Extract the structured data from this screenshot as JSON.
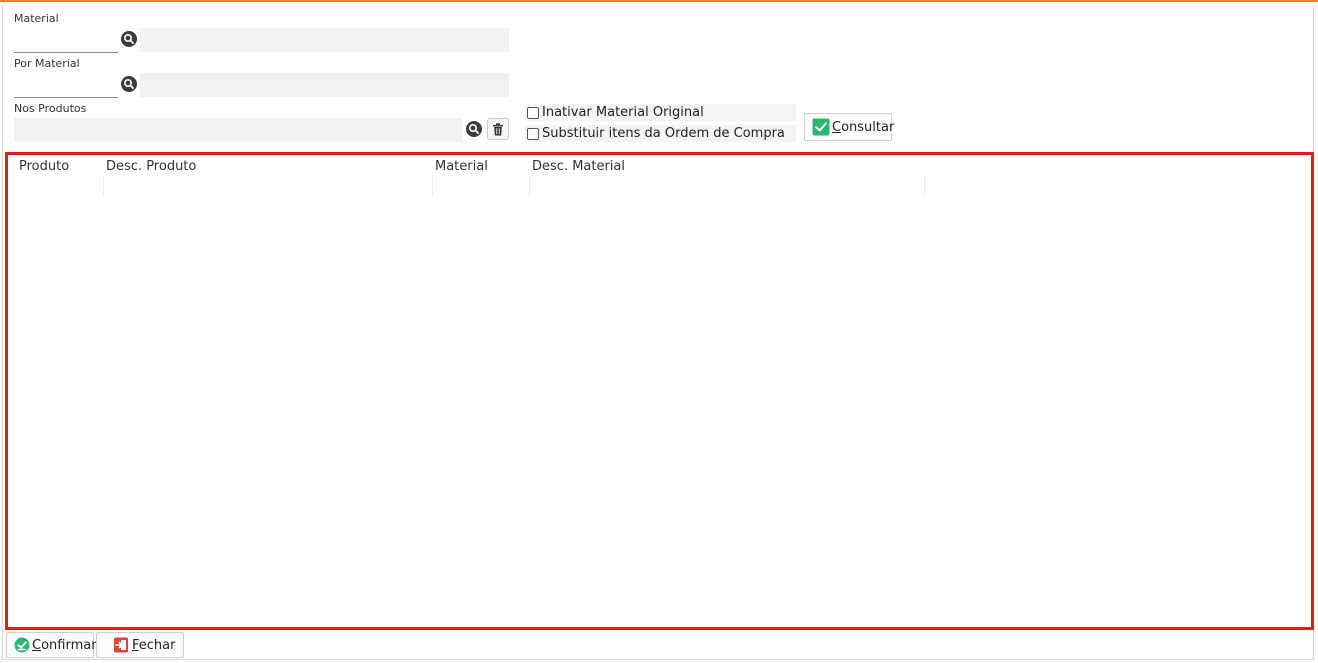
{
  "form": {
    "material_label": "Material",
    "material_value": "",
    "material_desc": "",
    "por_material_label": "Por Material",
    "por_material_value": "",
    "por_material_desc": "",
    "nos_produtos_label": "Nos Produtos",
    "nos_produtos_value": ""
  },
  "options": {
    "inativar_label": "Inativar Material Original",
    "inativar_checked": false,
    "substituir_label": "Substituir itens da Ordem de Compra",
    "substituir_checked": false
  },
  "buttons": {
    "consultar": "Consultar",
    "confirmar": "Confirmar",
    "fechar": "Fechar"
  },
  "grid": {
    "columns": [
      "Produto",
      "Desc. Produto",
      "Material",
      "Desc. Material"
    ],
    "rows": []
  },
  "colors": {
    "accent": "#f47b20",
    "highlight_border": "#e21b1b",
    "check_green": "#2bb673",
    "close_red": "#e0413b"
  },
  "icons": {
    "search": "search-icon",
    "trash": "trash-icon",
    "check": "check-icon",
    "exit": "exit-icon"
  }
}
